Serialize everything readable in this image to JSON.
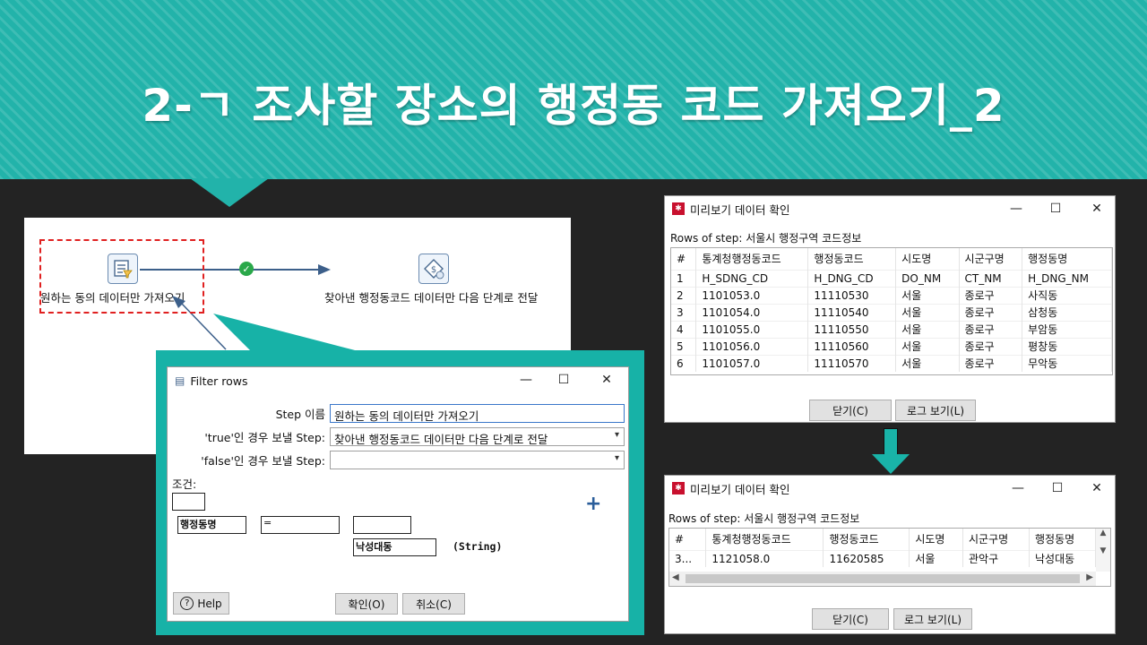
{
  "slide": {
    "title": "2-ㄱ 조사할 장소의 행정동 코드 가져오기_2"
  },
  "canvas": {
    "filter_step_label": "원하는 동의 데이터만 가져오기",
    "target_step_label": "찾아낸 행정동코드 데이터만 다음 단계로 전달"
  },
  "filter_dialog": {
    "title": "Filter rows",
    "step_name_label": "Step 이름",
    "step_name_value": "원하는 동의 데이터만 가져오기",
    "true_label": "'true'인 경우 보낼 Step:",
    "true_value": "찾아낸 행정동코드 데이터만 다음 단계로 전달",
    "false_label": "'false'인 경우 보낼 Step:",
    "false_value": "",
    "condition_label": "조건:",
    "cond_field": "행정동명",
    "cond_operator": "=",
    "cond_value": "낙성대동",
    "cond_type": "(String)",
    "add_symbol": "+",
    "help_label": "Help",
    "ok_label": "확인(O)",
    "cancel_label": "취소(C)"
  },
  "preview_top": {
    "title": "미리보기 데이터 확인",
    "rows_label": "Rows of step: 서울시 행정구역 코드정보",
    "columns": [
      "#",
      "통계청행정동코드",
      "행정동코드",
      "시도명",
      "시군구명",
      "행정동명"
    ],
    "rows": [
      [
        "1",
        "H_SDNG_CD",
        "H_DNG_CD",
        "DO_NM",
        "CT_NM",
        "H_DNG_NM"
      ],
      [
        "2",
        "1101053.0",
        "11110530",
        "서울",
        "종로구",
        "사직동"
      ],
      [
        "3",
        "1101054.0",
        "11110540",
        "서울",
        "종로구",
        "삼청동"
      ],
      [
        "4",
        "1101055.0",
        "11110550",
        "서울",
        "종로구",
        "부암동"
      ],
      [
        "5",
        "1101056.0",
        "11110560",
        "서울",
        "종로구",
        "평창동"
      ],
      [
        "6",
        "1101057.0",
        "11110570",
        "서울",
        "종로구",
        "무악동"
      ]
    ],
    "close_label": "닫기(C)",
    "log_label": "로그 보기(L)"
  },
  "preview_bottom": {
    "title": "미리보기 데이터 확인",
    "rows_label": "Rows of step: 서울시 행정구역 코드정보",
    "columns": [
      "#",
      "통계청행정동코드",
      "행정동코드",
      "시도명",
      "시군구명",
      "행정동명"
    ],
    "rows": [
      [
        "3...",
        "1121058.0",
        "11620585",
        "서울",
        "관악구",
        "낙성대동"
      ]
    ],
    "close_label": "닫기(C)",
    "log_label": "로그 보기(L)"
  },
  "colors": {
    "teal": "#22b3aa",
    "accent_red": "#e02020",
    "ok_green": "#2aa84a"
  }
}
